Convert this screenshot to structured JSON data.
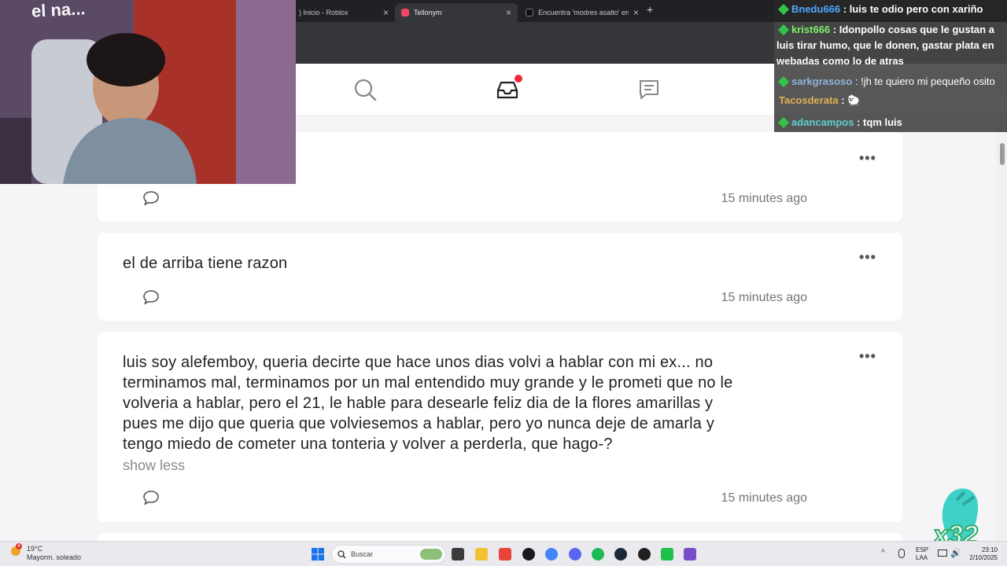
{
  "browser": {
    "tabs": [
      {
        "title": ") Inicio - Roblox",
        "active": false
      },
      {
        "title": "Tellonym",
        "active": true
      },
      {
        "title": "Encuentra 'modres asalto' en TikTok",
        "active": false
      }
    ],
    "new_tab_label": "+"
  },
  "nav": {
    "icons": [
      "search-icon",
      "inbox-icon",
      "messages-icon"
    ],
    "inbox_has_notification": true
  },
  "feed": {
    "cards": [
      {
        "text": "",
        "time": "15 minutes ago"
      },
      {
        "text": "el de arriba tiene razon",
        "time": "15 minutes ago"
      },
      {
        "lines": [
          "luis soy alefemboy, queria decirte que hace unos dias volvi a hablar con mi ex... no",
          "terminamos mal, terminamos por un mal entendido muy grande y le prometi que no le",
          "volveria a hablar, pero el 21, le hable para desearle feliz dia de la flores amarillas y",
          "pues me dijo que queria que volviesemos a hablar, pero yo nunca deje de amarla y",
          "tengo miedo de cometer una tonteria y volver a perderla, que hago-?"
        ],
        "show_less": "show less",
        "time": "15 minutes ago"
      }
    ],
    "more_label": "•••"
  },
  "webcam": {
    "overlay_text": "el na..."
  },
  "chat": {
    "messages": [
      {
        "user": "Bnedu666",
        "text": ": luis te odio pero con xariño",
        "user_color": "#4fa8ff"
      },
      {
        "user": "krist666",
        "text": ": Idonpollo cosas que le gustan a luis tirar humo, que le donen, gastar plata en webadas como lo de atras",
        "user_color": "#7cf26a"
      },
      {
        "user": "sarkgrasoso",
        "text": ": !jh te quiero mi pequeño osito",
        "user_color": "#8fb4d8"
      },
      {
        "user": "Tacosderata",
        "text": ":",
        "user_color": "#e0b050"
      },
      {
        "user": "adancampos",
        "text": ": tqm luis",
        "user_color": "#5fd0d0"
      }
    ]
  },
  "overlay": {
    "multiplier": "x32"
  },
  "taskbar": {
    "weather": {
      "temp": "19°C",
      "desc": "Mayorm. soleado",
      "notif": "4"
    },
    "search_placeholder": "Buscar",
    "lang": "ESP",
    "lang2": "LAA",
    "time": "23:10",
    "date": "2/10/2025",
    "app_colors": [
      "#3a3a3a",
      "#f2c233",
      "#e8443a",
      "#1a1a1a",
      "#4285f4",
      "#5865f2",
      "#1db954",
      "#1b2838",
      "#202020",
      "#1ec24a",
      "#7a4cc8"
    ]
  }
}
